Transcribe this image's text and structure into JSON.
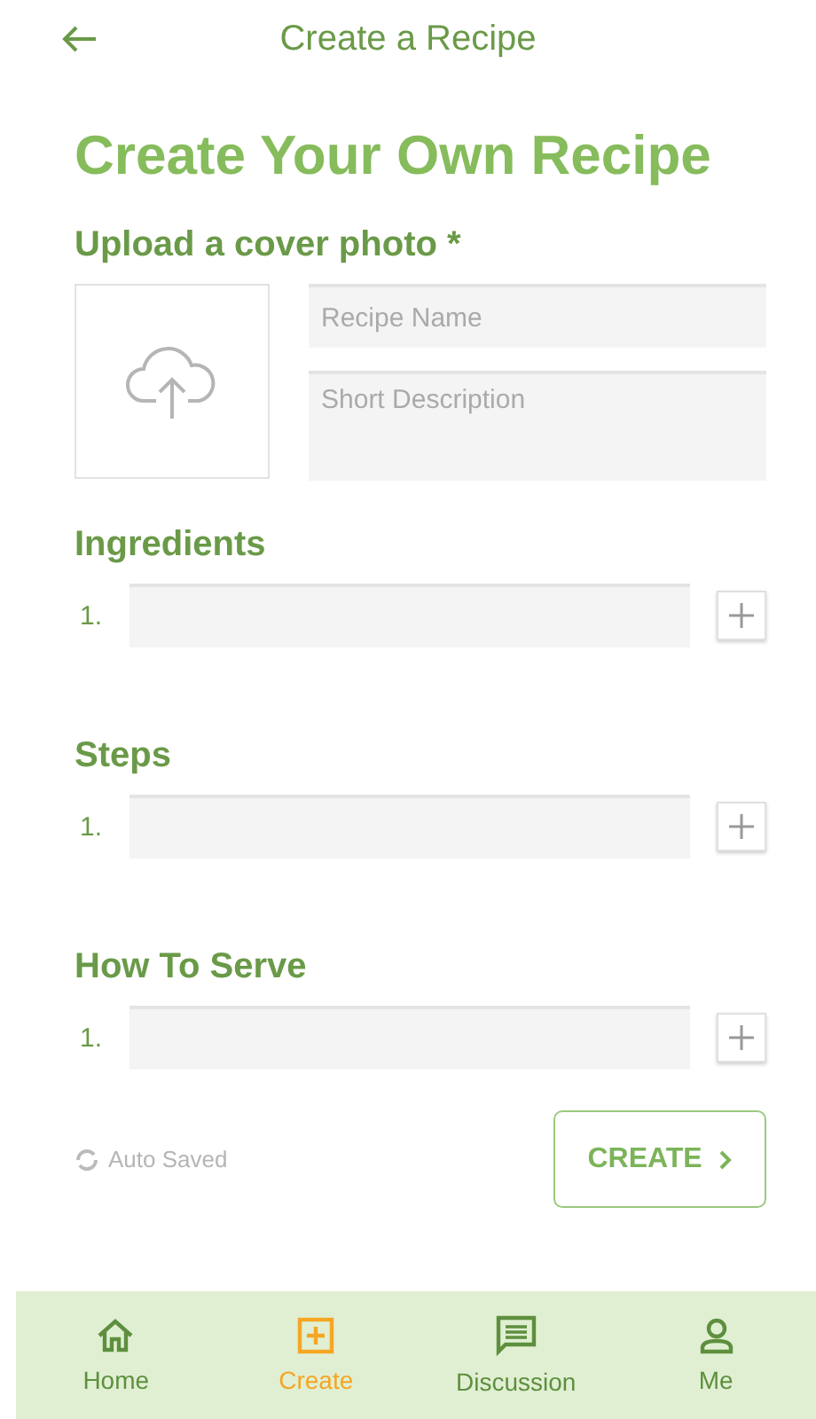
{
  "header": {
    "title": "Create a Recipe"
  },
  "heading": "Create Your Own Recipe",
  "upload": {
    "label": "Upload a cover photo *"
  },
  "fields": [
    {
      "placeholder": "Recipe Name",
      "kind": "line"
    },
    {
      "placeholder": "Short Description",
      "kind": "area"
    }
  ],
  "sections": [
    {
      "title": "Ingredients",
      "items": [
        {
          "number": "1."
        }
      ]
    },
    {
      "title": "Steps",
      "items": [
        {
          "number": "1."
        }
      ]
    },
    {
      "title": "How To Serve",
      "items": [
        {
          "number": "1."
        }
      ]
    }
  ],
  "status": "Auto Saved",
  "create_button": "CREATE",
  "nav": [
    {
      "label": "Home",
      "kind": "home",
      "selected": false
    },
    {
      "label": "Create",
      "kind": "create",
      "selected": true
    },
    {
      "label": "Discussion",
      "kind": "discussion",
      "selected": false
    },
    {
      "label": "Me",
      "kind": "me",
      "selected": false
    }
  ]
}
